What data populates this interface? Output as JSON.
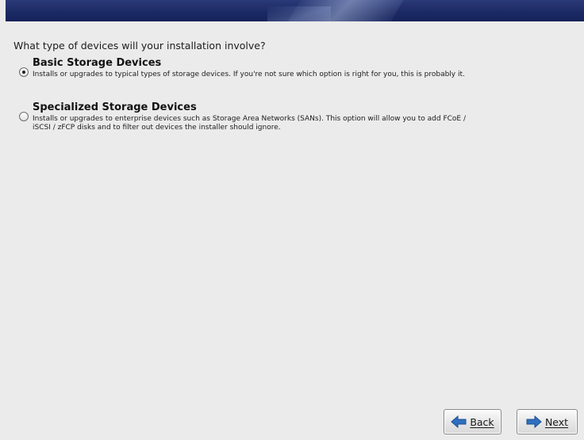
{
  "page": {
    "question": "What type of devices will your installation involve?"
  },
  "options": [
    {
      "title": "Basic Storage Devices",
      "description": "Installs or upgrades to typical types of storage devices.  If you're not sure which option is right for you, this is probably it.",
      "selected": true
    },
    {
      "title": "Specialized Storage Devices",
      "description": "Installs or upgrades to enterprise devices such as Storage Area Networks (SANs). This option will allow you to add FCoE / iSCSI / zFCP disks and to filter out devices the installer should ignore.",
      "selected": false
    }
  ],
  "buttons": {
    "back_label": "Back",
    "next_label": "Next",
    "back_icon": "arrow-left-icon",
    "next_icon": "arrow-right-icon"
  },
  "colors": {
    "banner": "#1c2a64",
    "background": "#ebebeb",
    "arrow": "#2f6fbf"
  }
}
